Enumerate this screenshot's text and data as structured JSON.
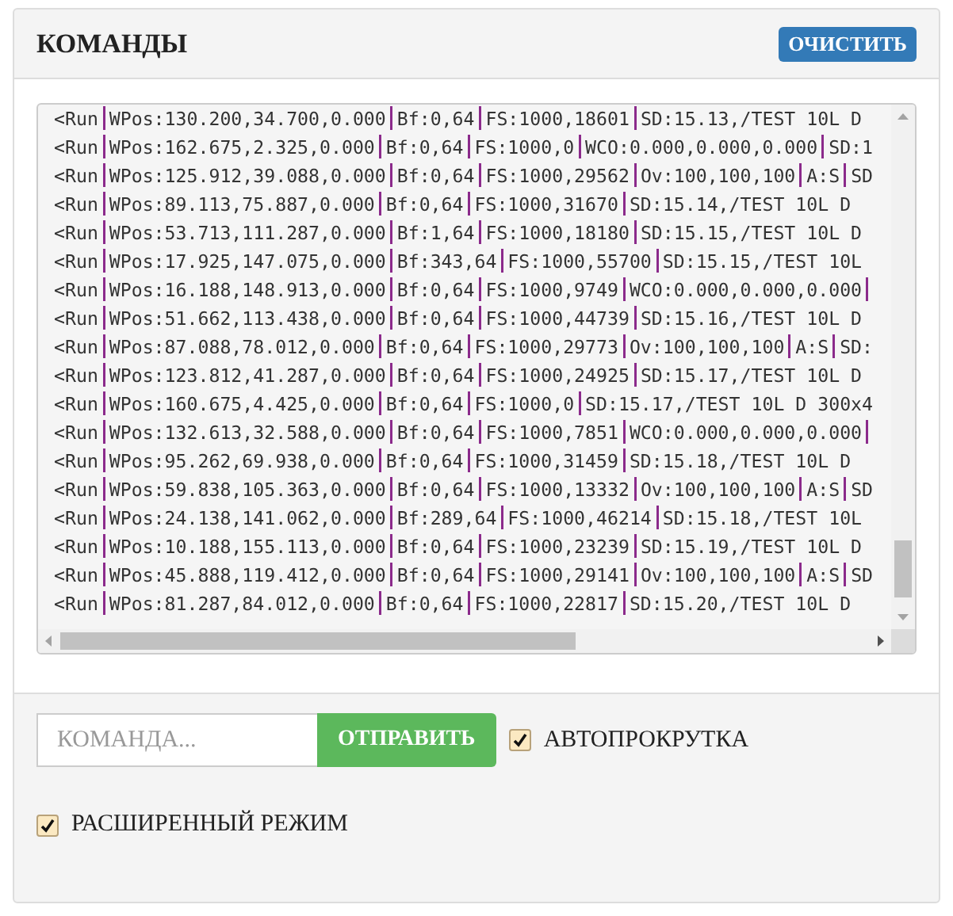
{
  "panel": {
    "title": "КОМАНДЫ",
    "clear_button": "ОЧИСТИТЬ"
  },
  "console": {
    "lines": [
      {
        "parts": [
          "<Run",
          "WPos:130.200,34.700,0.000",
          "Bf:0,64",
          "FS:1000,18601",
          "SD:15.13,/TEST 10L D"
        ]
      },
      {
        "parts": [
          "<Run",
          "WPos:162.675,2.325,0.000",
          "Bf:0,64",
          "FS:1000,0",
          "WCO:0.000,0.000,0.000",
          "SD:1"
        ]
      },
      {
        "parts": [
          "<Run",
          "WPos:125.912,39.088,0.000",
          "Bf:0,64",
          "FS:1000,29562",
          "Ov:100,100,100",
          "A:S",
          "SD"
        ]
      },
      {
        "parts": [
          "<Run",
          "WPos:89.113,75.887,0.000",
          "Bf:0,64",
          "FS:1000,31670",
          "SD:15.14,/TEST 10L D"
        ]
      },
      {
        "parts": [
          "<Run",
          "WPos:53.713,111.287,0.000",
          "Bf:1,64",
          "FS:1000,18180",
          "SD:15.15,/TEST 10L D"
        ]
      },
      {
        "parts": [
          "<Run",
          "WPos:17.925,147.075,0.000",
          "Bf:343,64",
          "FS:1000,55700",
          "SD:15.15,/TEST 10L"
        ]
      },
      {
        "parts": [
          "<Run",
          "WPos:16.188,148.913,0.000",
          "Bf:0,64",
          "FS:1000,9749",
          "WCO:0.000,0.000,0.000"
        ],
        "trailing_separator": true
      },
      {
        "parts": [
          "<Run",
          "WPos:51.662,113.438,0.000",
          "Bf:0,64",
          "FS:1000,44739",
          "SD:15.16,/TEST 10L D"
        ]
      },
      {
        "parts": [
          "<Run",
          "WPos:87.088,78.012,0.000",
          "Bf:0,64",
          "FS:1000,29773",
          "Ov:100,100,100",
          "A:S",
          "SD:"
        ]
      },
      {
        "parts": [
          "<Run",
          "WPos:123.812,41.287,0.000",
          "Bf:0,64",
          "FS:1000,24925",
          "SD:15.17,/TEST 10L D"
        ]
      },
      {
        "parts": [
          "<Run",
          "WPos:160.675,4.425,0.000",
          "Bf:0,64",
          "FS:1000,0",
          "SD:15.17,/TEST 10L D 300x4"
        ]
      },
      {
        "parts": [
          "<Run",
          "WPos:132.613,32.588,0.000",
          "Bf:0,64",
          "FS:1000,7851",
          "WCO:0.000,0.000,0.000"
        ],
        "trailing_separator": true
      },
      {
        "parts": [
          "<Run",
          "WPos:95.262,69.938,0.000",
          "Bf:0,64",
          "FS:1000,31459",
          "SD:15.18,/TEST 10L D"
        ]
      },
      {
        "parts": [
          "<Run",
          "WPos:59.838,105.363,0.000",
          "Bf:0,64",
          "FS:1000,13332",
          "Ov:100,100,100",
          "A:S",
          "SD"
        ]
      },
      {
        "parts": [
          "<Run",
          "WPos:24.138,141.062,0.000",
          "Bf:289,64",
          "FS:1000,46214",
          "SD:15.18,/TEST 10L"
        ]
      },
      {
        "parts": [
          "<Run",
          "WPos:10.188,155.113,0.000",
          "Bf:0,64",
          "FS:1000,23239",
          "SD:15.19,/TEST 10L D"
        ]
      },
      {
        "parts": [
          "<Run",
          "WPos:45.888,119.412,0.000",
          "Bf:0,64",
          "FS:1000,29141",
          "Ov:100,100,100",
          "A:S",
          "SD"
        ]
      },
      {
        "parts": [
          "<Run",
          "WPos:81.287,84.012,0.000",
          "Bf:0,64",
          "FS:1000,22817",
          "SD:15.20,/TEST 10L D"
        ]
      }
    ]
  },
  "command": {
    "placeholder": "КОМАНДА...",
    "send_button": "ОТПРАВИТЬ"
  },
  "options": [
    {
      "label": "АВТОПРОКРУТКА",
      "checked": true
    },
    {
      "label": "РАСШИРЕННЫЙ РЕЖИМ",
      "checked": true
    }
  ]
}
